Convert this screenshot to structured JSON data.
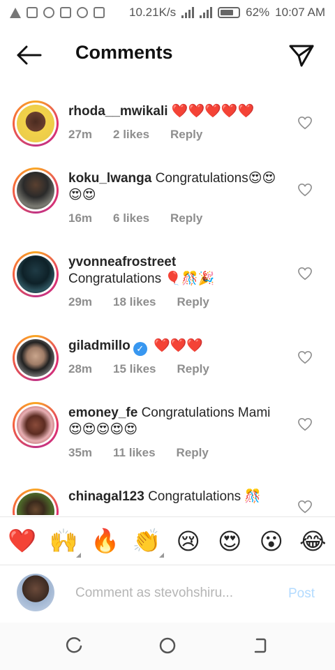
{
  "status_bar": {
    "speed": "10.21K/s",
    "battery": "62%",
    "time": "10:07 AM",
    "icons": [
      "alert-icon",
      "news-icon",
      "facebook-icon",
      "nfc-icon",
      "missed-call-icon",
      "image-icon",
      "wifi-signal-icon",
      "cell-signal-icon",
      "battery-icon"
    ]
  },
  "header": {
    "title": "Comments",
    "back_icon": "arrow-left-icon",
    "send_icon": "paper-plane-icon"
  },
  "comments": [
    {
      "username": "rhoda__mwikali",
      "text": "❤️❤️❤️❤️❤️",
      "time": "27m",
      "likes": "2 likes",
      "reply": "Reply",
      "verified": false
    },
    {
      "username": "koku_lwanga",
      "text": "Congratulations😍😍😍😍",
      "time": "16m",
      "likes": "6 likes",
      "reply": "Reply",
      "verified": false
    },
    {
      "username": "yvonneafrostreet",
      "text": "Congratulations 🎈🎊🎉",
      "time": "29m",
      "likes": "18 likes",
      "reply": "Reply",
      "verified": false
    },
    {
      "username": "giladmillo",
      "text": "❤️❤️❤️",
      "time": "28m",
      "likes": "15 likes",
      "reply": "Reply",
      "verified": true
    },
    {
      "username": "emoney_fe",
      "text": "Congratulations Mami 😍😍😍😍😍",
      "time": "35m",
      "likes": "11 likes",
      "reply": "Reply",
      "verified": false
    },
    {
      "username": "chinagal123",
      "text": "Congratulations 🎊",
      "time": "",
      "likes": "",
      "reply": "",
      "verified": false
    }
  ],
  "emoji_bar": [
    "❤️",
    "🙌",
    "🔥",
    "👏",
    "😢",
    "😍",
    "😮",
    "😂"
  ],
  "composer": {
    "placeholder": "Comment as stevohshiru...",
    "post_label": "Post"
  },
  "colors": {
    "post_disabled": "#b3dbff",
    "meta_gray": "#8e8e8e",
    "verified_blue": "#3897f0"
  }
}
